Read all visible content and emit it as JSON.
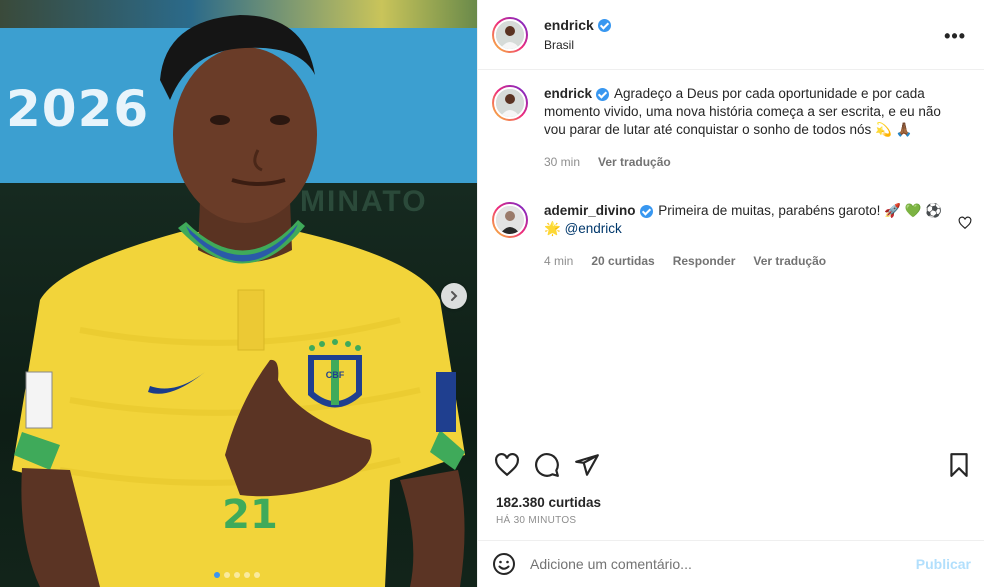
{
  "media": {
    "banner_year": "2026",
    "banner_faint": "MINATO",
    "jersey_number": "21",
    "badge_text": "CBF",
    "dots_total": 5,
    "dots_active_index": 0
  },
  "post": {
    "author": "endrick",
    "location": "Brasil",
    "caption": "Agradeço a Deus por cada oportunidade e por cada momento vivido, uma nova história começa a ser escrita, e eu não vou parar de lutar até conquistar o sonho de todos nós 💫 🙏🏾",
    "caption_time": "30 min",
    "caption_translate": "Ver tradução",
    "likes": "182.380 curtidas",
    "time_ago": "HÁ 30 MINUTOS"
  },
  "comments": [
    {
      "user": "ademir_divino",
      "text": "Primeira de muitas, parabéns garoto! 🚀 💚 ⚽ 🌟",
      "mention": "@endrick",
      "time": "4 min",
      "likes": "20 curtidas",
      "reply": "Responder",
      "translate": "Ver tradução"
    }
  ],
  "composer": {
    "placeholder": "Adicione um comentário...",
    "publish_label": "Publicar",
    "more_label": "•••"
  },
  "icons": {
    "header": [
      "more-options-icon"
    ],
    "actions": [
      "heart-icon",
      "comment-icon",
      "share-icon",
      "bookmark-icon"
    ],
    "composer": [
      "emoji-icon"
    ]
  },
  "colors": {
    "verified": "#3897f0",
    "publish_disabled": "#b2dffc",
    "muted": "#8e8e8e",
    "jersey": "#f4d93c",
    "collar": "#3faa5a",
    "banner": "#3c9fd0"
  }
}
